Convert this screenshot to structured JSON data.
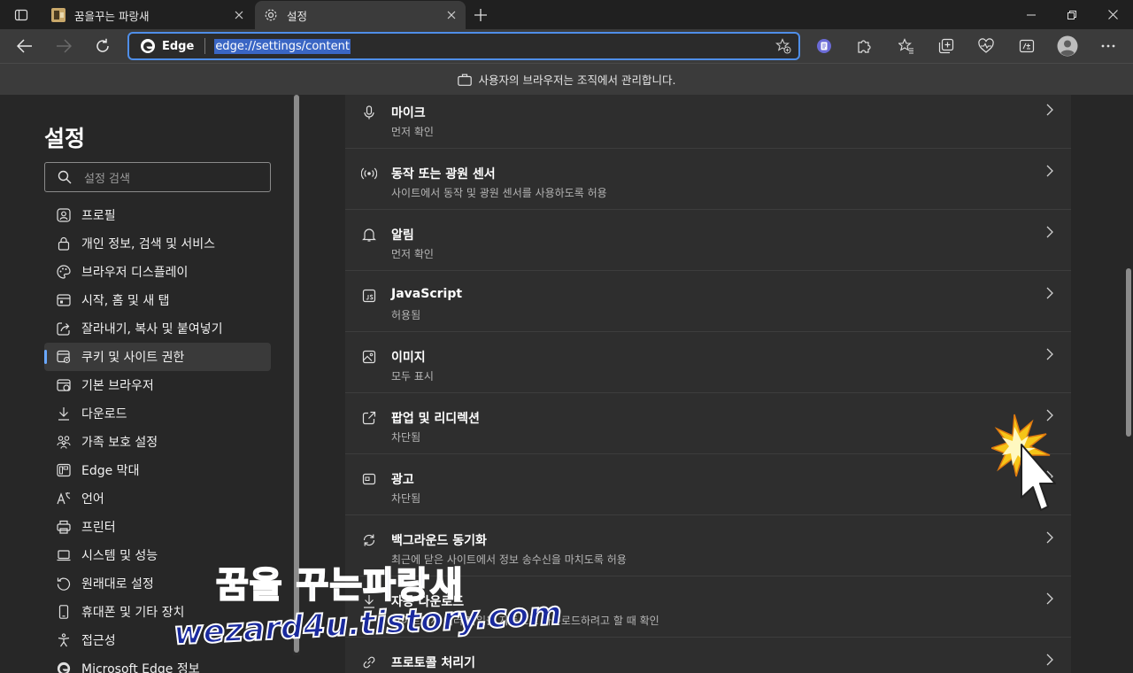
{
  "tabs": [
    {
      "title": "꿈을꾸는 파랑새",
      "icon": "blog-favicon-icon"
    },
    {
      "title": "설정",
      "icon": "gear-icon"
    }
  ],
  "address_bar": {
    "brand": "Edge",
    "url": "edge://settings/content"
  },
  "banner": {
    "text": "사용자의 브라우저는 조직에서 관리합니다."
  },
  "sidebar": {
    "title": "설정",
    "search_placeholder": "설정 검색",
    "items": [
      {
        "label": "프로필",
        "icon": "profile-icon"
      },
      {
        "label": "개인 정보, 검색 및 서비스",
        "icon": "lock-icon"
      },
      {
        "label": "브라우저 디스플레이",
        "icon": "palette-icon"
      },
      {
        "label": "시작, 홈 및 새 탭",
        "icon": "home-tab-icon"
      },
      {
        "label": "잘라내기, 복사 및 붙여넣기",
        "icon": "share-icon"
      },
      {
        "label": "쿠키 및 사이트 권한",
        "icon": "site-permissions-icon",
        "active": true
      },
      {
        "label": "기본 브라우저",
        "icon": "default-browser-icon"
      },
      {
        "label": "다운로드",
        "icon": "download-icon"
      },
      {
        "label": "가족 보호 설정",
        "icon": "family-icon"
      },
      {
        "label": "Edge 막대",
        "icon": "edge-bar-icon"
      },
      {
        "label": "언어",
        "icon": "language-icon"
      },
      {
        "label": "프린터",
        "icon": "printer-icon"
      },
      {
        "label": "시스템 및 성능",
        "icon": "system-icon"
      },
      {
        "label": "원래대로 설정",
        "icon": "reset-icon"
      },
      {
        "label": "휴대폰 및 기타 장치",
        "icon": "phone-icon"
      },
      {
        "label": "접근성",
        "icon": "accessibility-icon"
      },
      {
        "label": "Microsoft Edge 정보",
        "icon": "edge-logo-icon"
      }
    ]
  },
  "content": {
    "rows": [
      {
        "title": "마이크",
        "subtitle": "먼저 확인",
        "icon": "microphone-icon"
      },
      {
        "title": "동작 또는 광원 센서",
        "subtitle": "사이트에서 동작 및 광원 센서를 사용하도록 허용",
        "icon": "sensor-icon"
      },
      {
        "title": "알림",
        "subtitle": "먼저 확인",
        "icon": "bell-icon"
      },
      {
        "title": "JavaScript",
        "subtitle": "허용됨",
        "icon": "javascript-icon"
      },
      {
        "title": "이미지",
        "subtitle": "모두 표시",
        "icon": "image-icon"
      },
      {
        "title": "팝업 및 리디렉션",
        "subtitle": "차단됨",
        "icon": "popup-icon"
      },
      {
        "title": "광고",
        "subtitle": "차단됨",
        "icon": "ads-icon"
      },
      {
        "title": "백그라운드 동기화",
        "subtitle": "최근에 닫은 사이트에서 정보 송수신을 마치도록 허용",
        "icon": "sync-icon"
      },
      {
        "title": "자동 다운로드",
        "subtitle": "사이트에서 여러 파일을 자동으로 다운로드하려고 할 때 확인",
        "icon": "download-icon"
      },
      {
        "title": "프로토콜 처리기",
        "subtitle": "",
        "icon": "protocol-icon"
      }
    ]
  },
  "watermark": {
    "line1": "꿈을 꾸는파랑새",
    "line2": "wezard4u.tistory.com"
  },
  "colors": {
    "accent": "#4f8ee8",
    "page_bg": "#272727",
    "card_bg": "#2e2e2e"
  }
}
